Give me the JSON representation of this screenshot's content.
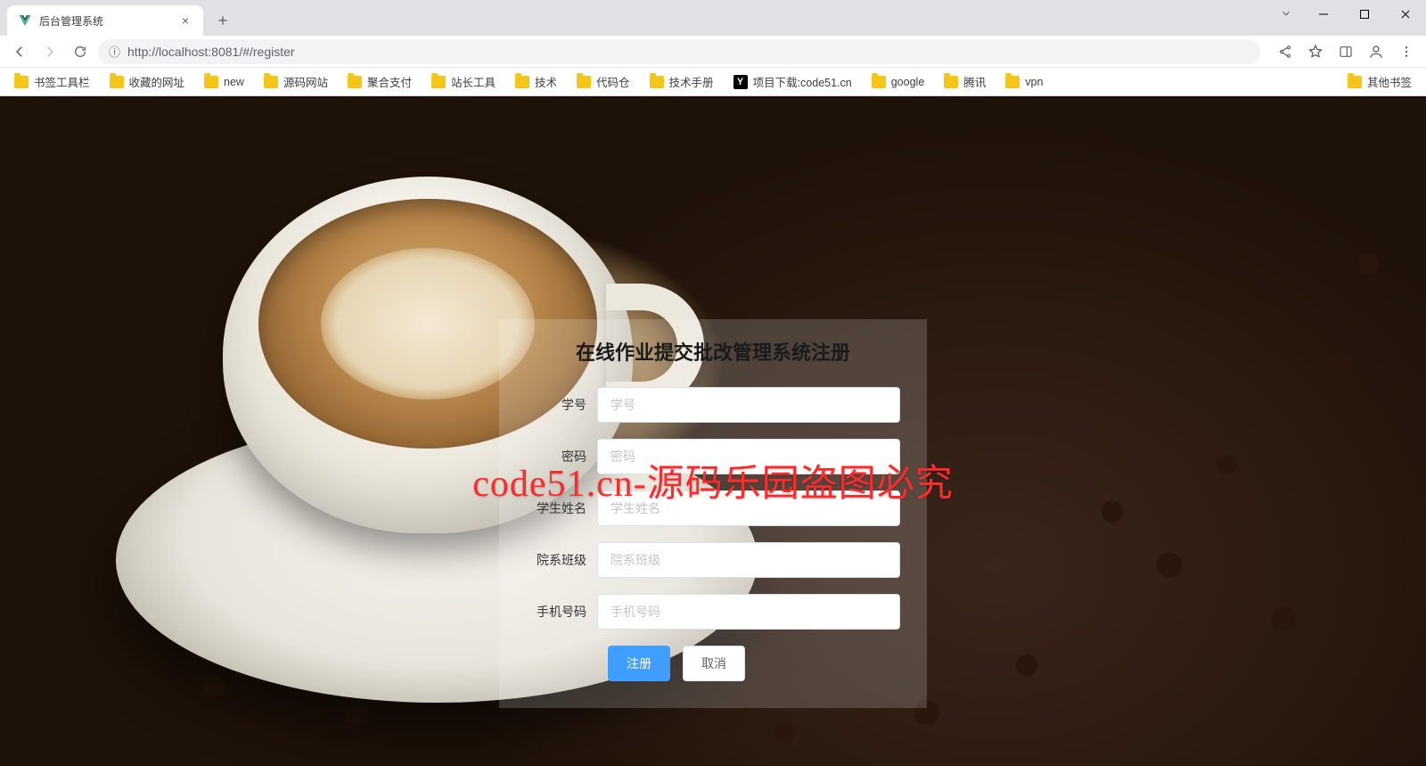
{
  "browser": {
    "tab_title": "后台管理系统",
    "url_display": "http://localhost:8081/#/register",
    "url_host": "localhost",
    "url_port": ":8081",
    "url_path": "/#/register",
    "info_icon_label": "ⓘ"
  },
  "bookmarks": {
    "items": [
      {
        "label": "书签工具栏",
        "type": "folder"
      },
      {
        "label": "收藏的网址",
        "type": "folder"
      },
      {
        "label": "new",
        "type": "folder"
      },
      {
        "label": "源码网站",
        "type": "folder"
      },
      {
        "label": "聚合支付",
        "type": "folder"
      },
      {
        "label": "站长工具",
        "type": "folder"
      },
      {
        "label": "技术",
        "type": "folder"
      },
      {
        "label": "代码仓",
        "type": "folder"
      },
      {
        "label": "技术手册",
        "type": "folder"
      },
      {
        "label": "项目下载:code51.cn",
        "type": "y"
      },
      {
        "label": "google",
        "type": "folder"
      },
      {
        "label": "腾讯",
        "type": "folder"
      },
      {
        "label": "vpn",
        "type": "folder"
      }
    ],
    "overflow_label": "其他书签"
  },
  "form": {
    "title": "在线作业提交批改管理系统注册",
    "fields": {
      "student_id": {
        "label": "学号",
        "placeholder": "学号",
        "value": ""
      },
      "password": {
        "label": "密码",
        "placeholder": "密码",
        "value": ""
      },
      "name": {
        "label": "学生姓名",
        "placeholder": "学生姓名",
        "value": ""
      },
      "class": {
        "label": "院系班级",
        "placeholder": "院系班级",
        "value": ""
      },
      "phone": {
        "label": "手机号码",
        "placeholder": "手机号码",
        "value": ""
      }
    },
    "buttons": {
      "submit": "注册",
      "cancel": "取消"
    }
  },
  "watermark": "code51.cn-源码乐园盗图必究"
}
